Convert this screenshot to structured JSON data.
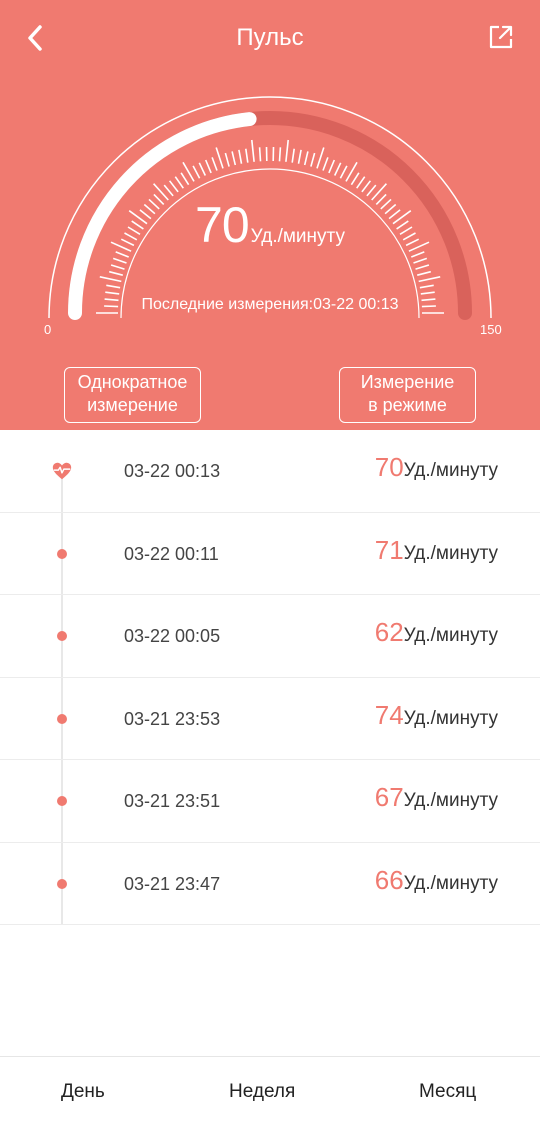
{
  "header": {
    "title": "Пульс",
    "accent_color": "#f07a70"
  },
  "gauge": {
    "value": "70",
    "unit": "Уд./минуту",
    "min_label": "0",
    "max_label": "150",
    "min": 0,
    "max": 150,
    "current": 70,
    "last_measurement": "Последние измерения:03-22 00:13"
  },
  "buttons": {
    "single": "Однократное измерение",
    "continuous": "Измерение в режиме"
  },
  "records": [
    {
      "time": "03-22 00:13",
      "value": "70",
      "unit": "Уд./минуту",
      "icon": "heart-pulse-icon"
    },
    {
      "time": "03-22 00:11",
      "value": "71",
      "unit": "Уд./минуту",
      "icon": "dot"
    },
    {
      "time": "03-22 00:05",
      "value": "62",
      "unit": "Уд./минуту",
      "icon": "dot"
    },
    {
      "time": "03-21 23:53",
      "value": "74",
      "unit": "Уд./минуту",
      "icon": "dot"
    },
    {
      "time": "03-21 23:51",
      "value": "67",
      "unit": "Уд./минуту",
      "icon": "dot"
    },
    {
      "time": "03-21 23:47",
      "value": "66",
      "unit": "Уд./минуту",
      "icon": "dot"
    }
  ],
  "tabs": {
    "day": "День",
    "week": "Неделя",
    "month": "Месяц"
  }
}
